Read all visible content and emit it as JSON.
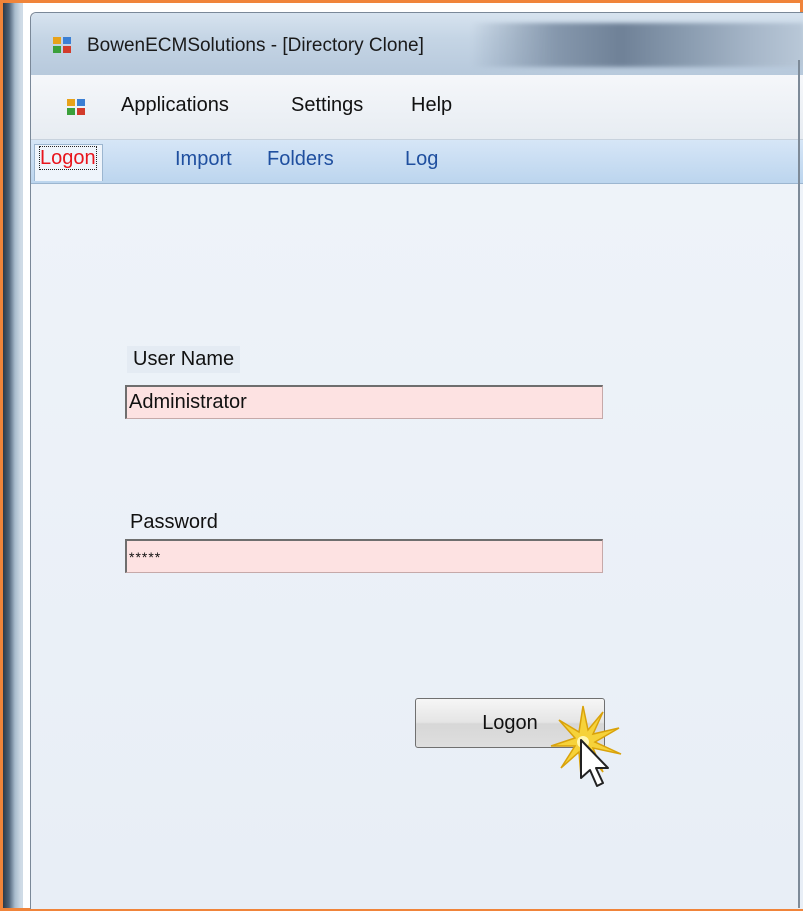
{
  "window": {
    "title": "BowenECMSolutions - [Directory Clone]",
    "app_icon": "app-window-icon"
  },
  "menu": {
    "items": [
      {
        "label": "Applications"
      },
      {
        "label": "Settings"
      },
      {
        "label": "Help"
      }
    ]
  },
  "tabs": [
    {
      "label": "Logon",
      "active": true
    },
    {
      "label": "Import",
      "active": false
    },
    {
      "label": "Folders",
      "active": false
    },
    {
      "label": "Log",
      "active": false
    }
  ],
  "form": {
    "username_label": "User Name",
    "username_value": "Administrator",
    "password_label": "Password",
    "password_value": "*****",
    "logon_button": "Logon"
  },
  "colors": {
    "frame_border": "#f0843a",
    "active_tab_text": "#e8141c",
    "tab_text": "#1f4f9f",
    "field_background": "#fde2e2"
  },
  "cursor": {
    "icon": "mouse-pointer-click-icon"
  }
}
